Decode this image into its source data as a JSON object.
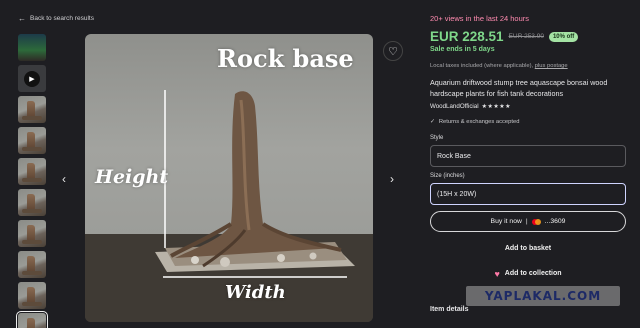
{
  "nav": {
    "back_label": "Back to search results"
  },
  "gallery": {
    "thumbnail_count": 10,
    "image_labels": {
      "main": "Rock base",
      "height": "Height",
      "width": "Width"
    }
  },
  "listing": {
    "views_text": "20+ views in the last 24 hours",
    "price": "EUR 228.51",
    "original_price": "EUR 253.90",
    "discount": "10% off",
    "sale_text": "Sale ends in 5 days",
    "taxes_text": "Local taxes included (where applicable),",
    "postage_link": "plus postage",
    "title": "Aquarium driftwood stump tree aquascape bonsai wood hardscape plants for fish tank decorations",
    "shop_name": "WoodLandOfficial",
    "stars": "★★★★★",
    "returns_text": "Returns & exchanges accepted"
  },
  "options": {
    "style_label": "Style",
    "style_value": "Rock Base",
    "size_label": "Size (inches)",
    "size_value": "(15H x 20W)"
  },
  "actions": {
    "buy_now": "Buy it now",
    "card_last4": "...3609",
    "add_to_basket": "Add to basket",
    "add_to_collection": "Add to collection"
  },
  "sections": {
    "item_details": "Item details"
  },
  "watermark": "YAPLAKAL.COM",
  "colors": {
    "price_green": "#7fd78a",
    "views_pink": "#ff8bb0",
    "background": "#1e1e22"
  }
}
